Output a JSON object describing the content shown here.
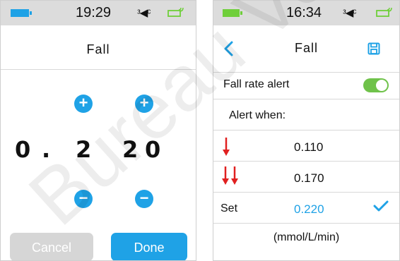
{
  "colors": {
    "accent_blue": "#1fa2e6",
    "accent_green": "#6fcf3a",
    "alert_red": "#e02020",
    "status_bar_bg": "#dcdcdc",
    "cancel_disabled": "#d6d6d6"
  },
  "left_screen": {
    "status_bar": {
      "time": "19:29",
      "battery_icon": "battery-icon",
      "vibrate_symbol": "ᵌ◀ᶜ",
      "signal_icon": "signal-icon"
    },
    "title": "Fall",
    "stepper": {
      "digits": [
        "0",
        ".",
        "2",
        "2",
        "0"
      ],
      "increase_icon": "plus-circle-icon",
      "decrease_icon": "minus-circle-icon"
    },
    "buttons": {
      "cancel": "Cancel",
      "done": "Done"
    }
  },
  "right_screen": {
    "status_bar": {
      "time": "16:34",
      "battery_icon": "battery-icon",
      "vibrate_symbol": "ᵌ◀ᶜ",
      "signal_icon": "signal-icon"
    },
    "title": "Fall",
    "back_icon": "chevron-left-icon",
    "save_icon": "save-icon",
    "fall_rate_alert": {
      "label": "Fall rate alert",
      "enabled": true
    },
    "alert_when_label": "Alert when:",
    "options": [
      {
        "label": "",
        "value": "0.110",
        "arrow": "single-down-arrow"
      },
      {
        "label": "",
        "value": "0.170",
        "arrow": "double-down-arrow"
      },
      {
        "label": "Set",
        "value": "0.220",
        "selected": true
      }
    ],
    "units": "(mmol/L/min)"
  },
  "watermark": "Bureau Veritas"
}
